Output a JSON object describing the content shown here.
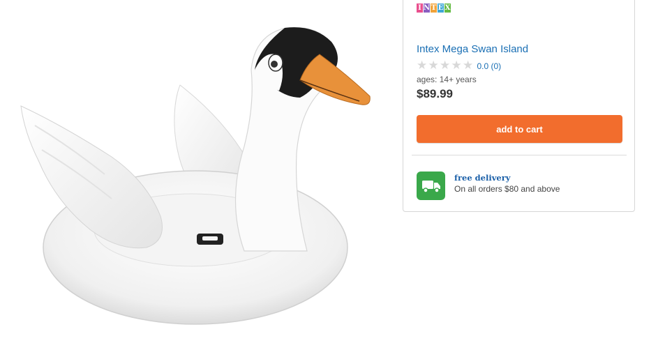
{
  "product": {
    "brand": "INTEX",
    "brand_colors": [
      "#e94f8e",
      "#8a5ec0",
      "#f0a33a",
      "#3fa7d6",
      "#66bb45"
    ],
    "name": "Intex Mega Swan Island",
    "rating_stars_filled": 0,
    "rating_stars_total": 5,
    "rating_text": "0.0 (0)",
    "ages": "ages: 14+ years",
    "price": "$89.99",
    "add_to_cart_label": "add to cart"
  },
  "delivery": {
    "title": "free delivery",
    "subtitle": "On all orders $80 and above",
    "icon": "truck-icon"
  },
  "colors": {
    "link": "#1a6fb4",
    "cart_button": "#f26d2d",
    "delivery_icon_bg": "#3aa84a"
  }
}
